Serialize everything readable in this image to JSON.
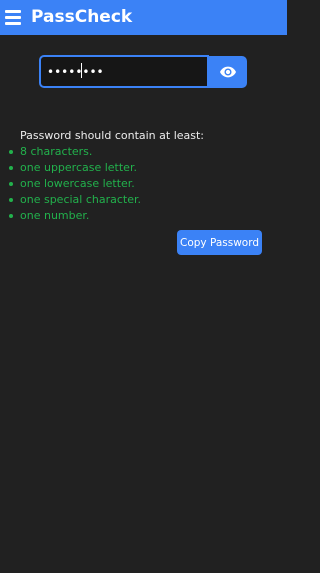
{
  "app_bar": {
    "title": "PassCheck",
    "background": "#3b82f6",
    "menu_icon": "hamburger-menu-icon"
  },
  "password": {
    "masked_value": "••••••••",
    "visibility_icon": "eye-icon",
    "accent": "#3b82f6"
  },
  "requirements": {
    "heading": "Password should contain at least:",
    "status_color": "#22b14c",
    "items": [
      "8 characters.",
      "one uppercase letter.",
      "one lowercase letter.",
      "one special character.",
      "one number."
    ]
  },
  "actions": {
    "copy_label": "Copy Password"
  }
}
